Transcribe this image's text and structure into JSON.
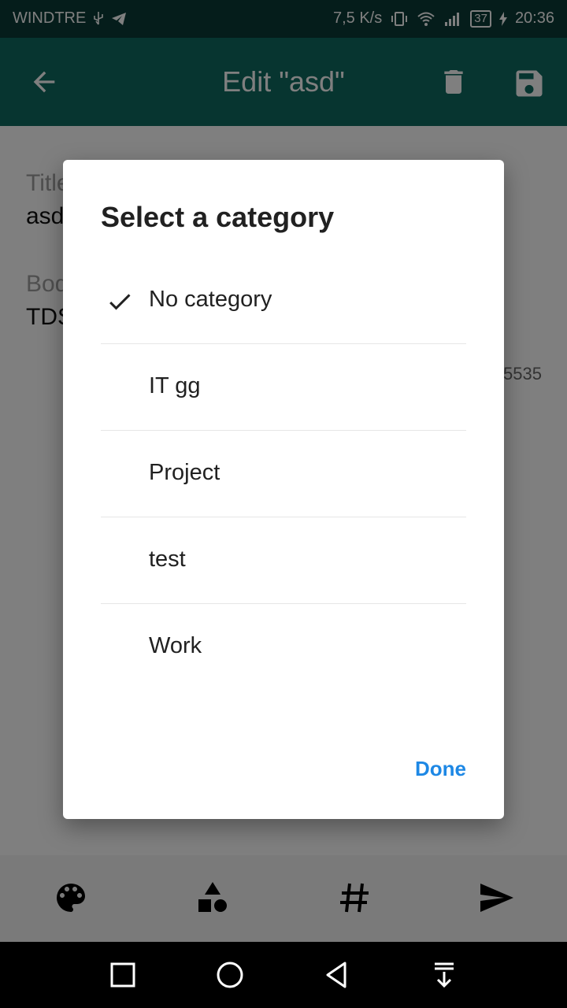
{
  "status_bar": {
    "carrier": "WINDTRE",
    "speed": "7,5 K/s",
    "battery": "37",
    "time": "20:36"
  },
  "app_bar": {
    "title": "Edit \"asd\""
  },
  "form": {
    "title_label": "Title",
    "title_value": "asd",
    "body_label": "Body",
    "body_value": "TDS",
    "counter": "5535"
  },
  "dialog": {
    "title": "Select a category",
    "items": [
      {
        "label": "No category",
        "checked": true
      },
      {
        "label": "IT gg",
        "checked": false
      },
      {
        "label": "Project",
        "checked": false
      },
      {
        "label": "test",
        "checked": false
      },
      {
        "label": "Work",
        "checked": false
      }
    ],
    "done_label": "Done"
  },
  "toolbar": {
    "icons": [
      "palette-icon",
      "shapes-icon",
      "hashtag-icon",
      "send-icon"
    ]
  },
  "colors": {
    "app_bar": "#0f6b60",
    "status_bar": "#0b3b36",
    "accent": "#1e88e5"
  }
}
